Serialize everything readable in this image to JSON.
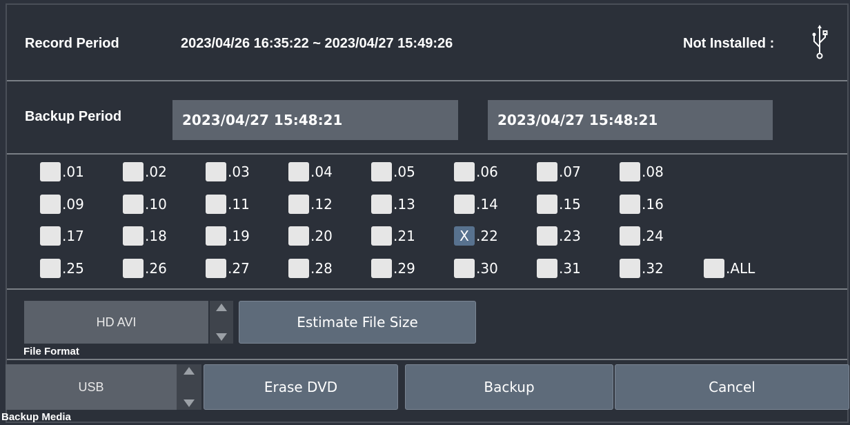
{
  "record": {
    "label": "Record Period",
    "value": "2023/04/26 16:35:22 ~ 2023/04/27 15:49:26",
    "status": "Not Installed :",
    "status_icon": "usb-icon"
  },
  "backup": {
    "label": "Backup Period",
    "start": "2023/04/27 15:48:21",
    "end": "2023/04/27 15:48:21"
  },
  "channels": [
    {
      "label": ".01",
      "checked": false
    },
    {
      "label": ".02",
      "checked": false
    },
    {
      "label": ".03",
      "checked": false
    },
    {
      "label": ".04",
      "checked": false
    },
    {
      "label": ".05",
      "checked": false
    },
    {
      "label": ".06",
      "checked": false
    },
    {
      "label": ".07",
      "checked": false
    },
    {
      "label": ".08",
      "checked": false
    },
    {
      "label": ".09",
      "checked": false
    },
    {
      "label": ".10",
      "checked": false
    },
    {
      "label": ".11",
      "checked": false
    },
    {
      "label": ".12",
      "checked": false
    },
    {
      "label": ".13",
      "checked": false
    },
    {
      "label": ".14",
      "checked": false
    },
    {
      "label": ".15",
      "checked": false
    },
    {
      "label": ".16",
      "checked": false
    },
    {
      "label": ".17",
      "checked": false
    },
    {
      "label": ".18",
      "checked": false
    },
    {
      "label": ".19",
      "checked": false
    },
    {
      "label": ".20",
      "checked": false
    },
    {
      "label": ".21",
      "checked": false
    },
    {
      "label": ".22",
      "checked": true
    },
    {
      "label": ".23",
      "checked": false
    },
    {
      "label": ".24",
      "checked": false
    },
    {
      "label": ".25",
      "checked": false
    },
    {
      "label": ".26",
      "checked": false
    },
    {
      "label": ".27",
      "checked": false
    },
    {
      "label": ".28",
      "checked": false
    },
    {
      "label": ".29",
      "checked": false
    },
    {
      "label": ".30",
      "checked": false
    },
    {
      "label": ".31",
      "checked": false
    },
    {
      "label": ".32",
      "checked": false
    }
  ],
  "all": {
    "label": ".ALL",
    "checked": false
  },
  "check_mark": "X",
  "format": {
    "value": "HD AVI",
    "label": "File Format",
    "estimate_button": "Estimate File Size"
  },
  "media": {
    "value": "USB",
    "label": "Backup Media"
  },
  "buttons": {
    "erase": "Erase DVD",
    "backup": "Backup",
    "cancel": "Cancel"
  },
  "colors": {
    "background": "#2b3039",
    "field": "#5d646e",
    "button": "#5e6b7a",
    "checked": "#58728f"
  }
}
